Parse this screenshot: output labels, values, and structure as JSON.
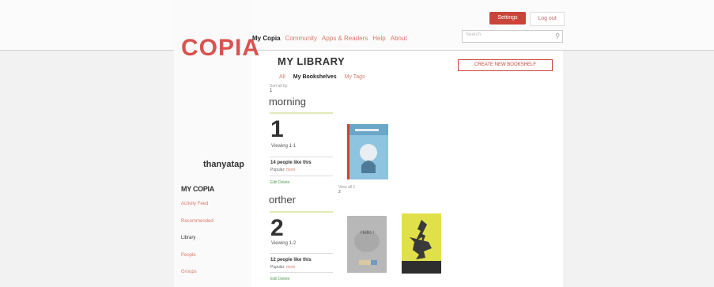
{
  "header": {
    "logo": "COPIA",
    "nav": [
      "My Copia",
      "Community",
      "Apps & Readers",
      "Help",
      "About"
    ],
    "settings_label": "Settings",
    "logout_label": "Log out",
    "search_placeholder": "Search"
  },
  "main": {
    "title": "MY LIBRARY",
    "create_button": "CREATE NEW BOOKSHELF",
    "tabs": [
      "All",
      "My Bookshelves",
      "My Tags"
    ],
    "sort_label": "Sort all by:",
    "sort_value": "1",
    "shelves": [
      {
        "name": "morning",
        "count": "1",
        "viewing": "Viewing 1-1",
        "people": "14 people like this",
        "popular": "Popular:",
        "popular_link": "more",
        "edit": "Edit Delete"
      },
      {
        "name": "orther",
        "count": "2",
        "viewing": "Viewing 1-2",
        "people": "12 people like this",
        "popular": "Popular:",
        "popular_link": "more",
        "edit": "Edit Delete"
      }
    ],
    "small_note": "View all 1",
    "small_num": "2",
    "book_cover_text": "Hello !"
  },
  "sidebar": {
    "username": "thanyatap",
    "section_title": "MY COPIA",
    "items": [
      "Activity Feed",
      "Recommended",
      "Library",
      "People",
      "Groups"
    ]
  },
  "colors": {
    "accent": "#c9453a",
    "link": "#d97a6c",
    "logo": "#d9534f"
  }
}
